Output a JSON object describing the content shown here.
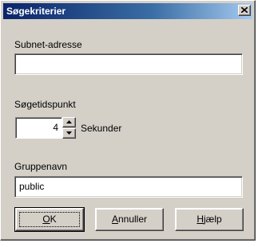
{
  "window": {
    "title": "Søgekriterier"
  },
  "fields": {
    "subnet_label": "Subnet-adresse",
    "subnet_value": "",
    "time_label": "Søgetidspunkt",
    "time_value": "4",
    "time_unit": "Sekunder",
    "group_label": "Gruppenavn",
    "group_value": "public"
  },
  "buttons": {
    "ok": {
      "underline": "O",
      "rest": "K"
    },
    "cancel": {
      "underline": "A",
      "rest": "nnuller"
    },
    "help": {
      "underline": "H",
      "rest": "jælp"
    }
  }
}
